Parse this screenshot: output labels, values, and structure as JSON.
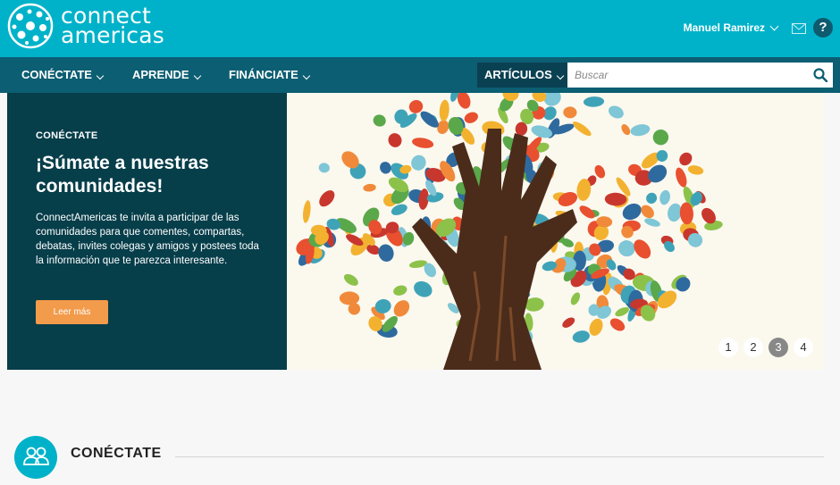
{
  "header": {
    "logo_line1": "connect",
    "logo_line2": "americas",
    "user_name": "Manuel Ramirez",
    "help_label": "?"
  },
  "nav": {
    "items": [
      {
        "label": "CONÉCTATE"
      },
      {
        "label": "APRENDE"
      },
      {
        "label": "FINÁNCIATE"
      }
    ],
    "search_category": "ARTÍCULOS",
    "search_placeholder": "Buscar",
    "search_value": ""
  },
  "hero": {
    "kicker": "CONÉCTATE",
    "title": "¡Súmate a nuestras comunidades!",
    "body": "ConnectAmericas te invita a participar de las comunidades para que comentes, compartas, debatas, invites colegas y amigos y postees toda la información que te parezca interesante.",
    "button_label": "Leer más",
    "pager": [
      "1",
      "2",
      "3",
      "4"
    ],
    "active_page": "3"
  },
  "section": {
    "title": "CONÉCTATE",
    "icon": "users-icon"
  },
  "colors": {
    "brand": "#00b2c9",
    "nav": "#0c5e72",
    "hero_panel": "#063e4a",
    "accent": "#f29b4b"
  }
}
